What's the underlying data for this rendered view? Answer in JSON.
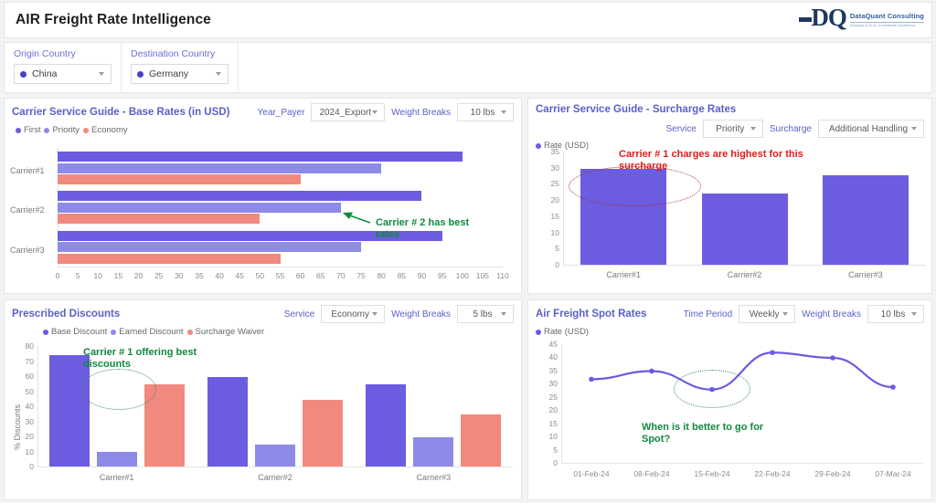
{
  "header": {
    "title": "AIR Freight Rate Intelligence",
    "logo_initials": "DQ",
    "logo_name": "DataQuant Consulting",
    "logo_tagline": "Analytics & AI for Commercial Excellence"
  },
  "filters": [
    {
      "label": "Origin Country",
      "value": "China"
    },
    {
      "label": "Destination Country",
      "value": "Germany"
    }
  ],
  "panels": {
    "base_rates": {
      "title": "Carrier Service Guide - Base Rates (in USD)",
      "controls": [
        {
          "label": "Year_Payer",
          "value": "2024_Export"
        },
        {
          "label": "Weight Breaks",
          "value": "10 lbs"
        }
      ],
      "annotation": "Carrier # 2 has best\nrates"
    },
    "surcharge_rates": {
      "title": "Carrier Service Guide - Surcharge Rates",
      "controls": [
        {
          "label": "Service",
          "value": "Priority"
        },
        {
          "label": "Surcharge",
          "value": "Additional Handling"
        }
      ],
      "annotation": "Carrier # 1 charges are highest for this\nsurcharge"
    },
    "discounts": {
      "title": "Prescribed Discounts",
      "controls": [
        {
          "label": "Service",
          "value": "Economy"
        },
        {
          "label": "Weight Breaks",
          "value": "5 lbs"
        }
      ],
      "annotation": "Carrier # 1 offering best\ndiscounts"
    },
    "spot_rates": {
      "title": "Air Freight Spot Rates",
      "controls": [
        {
          "label": "Time Period",
          "value": "Weekly"
        },
        {
          "label": "Weight Breaks",
          "value": "10 lbs"
        }
      ],
      "annotation": "When is it better to go for\nSpot?"
    }
  },
  "colors": {
    "series_first": "#6b5ce0",
    "series_priority": "#8e8ae8",
    "series_economy": "#f2897f",
    "accent": "#5b5fc7",
    "annotation_green": "#13883f",
    "annotation_red": "#e01b1b"
  },
  "chart_data": [
    {
      "id": "base_rates",
      "type": "bar",
      "orientation": "horizontal",
      "title": "Carrier Service Guide - Base Rates (in USD)",
      "categories": [
        "Carrier#1",
        "Carrier#2",
        "Carrier#3"
      ],
      "series": [
        {
          "name": "First",
          "color": "#6b5ce0",
          "values": [
            100,
            90,
            95
          ]
        },
        {
          "name": "Priority",
          "color": "#8e8ae8",
          "values": [
            80,
            70,
            75
          ]
        },
        {
          "name": "Economy",
          "color": "#f2897f",
          "values": [
            60,
            50,
            55
          ]
        }
      ],
      "xlabel": "",
      "ylabel": "",
      "xlim": [
        0,
        110
      ],
      "xticks": [
        0,
        5,
        10,
        15,
        20,
        25,
        30,
        35,
        40,
        45,
        50,
        55,
        60,
        65,
        70,
        75,
        80,
        85,
        90,
        95,
        100,
        105,
        110
      ],
      "grid": false,
      "legend_position": "top-left",
      "annotations": [
        {
          "text": "Carrier # 2 has best rates",
          "color": "#13883f",
          "points_to": "Carrier#2 Priority"
        }
      ]
    },
    {
      "id": "surcharge_rates",
      "type": "bar",
      "orientation": "vertical",
      "title": "Carrier Service Guide - Surcharge Rates",
      "categories": [
        "Carrier#1",
        "Carrier#2",
        "Carrier#3"
      ],
      "series": [
        {
          "name": "Rate (USD)",
          "color": "#6b5ce0",
          "values": [
            29.5,
            21.9,
            27.7
          ]
        }
      ],
      "xlabel": "",
      "ylabel": "Rate (USD)",
      "ylim": [
        0,
        35
      ],
      "yticks": [
        0,
        5,
        10,
        15,
        20,
        25,
        30,
        35
      ],
      "grid": false,
      "legend_position": "top-left",
      "annotations": [
        {
          "text": "Carrier # 1 charges are highest for this surcharge",
          "color": "#e01b1b",
          "highlight": "Carrier#1"
        }
      ]
    },
    {
      "id": "discounts",
      "type": "bar",
      "orientation": "vertical",
      "title": "Prescribed Discounts",
      "categories": [
        "Carrier#1",
        "Carrier#2",
        "Carrier#3"
      ],
      "series": [
        {
          "name": "Base Discount",
          "color": "#6b5ce0",
          "values": [
            74,
            59.5,
            54.5
          ]
        },
        {
          "name": "Earned Discount",
          "color": "#8e8ae8",
          "values": [
            9.5,
            14.5,
            19.5
          ]
        },
        {
          "name": "Surcharge Waiver",
          "color": "#f2897f",
          "values": [
            54.5,
            44.5,
            34.5
          ]
        }
      ],
      "xlabel": "",
      "ylabel": "% Discounts",
      "ylim": [
        0,
        80
      ],
      "yticks": [
        0,
        10,
        20,
        30,
        40,
        50,
        60,
        70,
        80
      ],
      "grid": false,
      "legend_position": "top",
      "annotations": [
        {
          "text": "Carrier # 1 offering best discounts",
          "color": "#13883f",
          "highlight": "Carrier#1"
        }
      ]
    },
    {
      "id": "spot_rates",
      "type": "line",
      "title": "Air Freight Spot Rates",
      "x": [
        "01-Feb-24",
        "08-Feb-24",
        "15-Feb-24",
        "22-Feb-24",
        "29-Feb-24",
        "07-Mar-24"
      ],
      "series": [
        {
          "name": "Rate (USD)",
          "color": "#6b5ce0",
          "values": [
            31.7,
            34.8,
            27.8,
            41.8,
            39.8,
            28.7
          ]
        }
      ],
      "xlabel": "",
      "ylabel": "Rate (USD)",
      "ylim": [
        0,
        45
      ],
      "yticks": [
        0,
        5,
        10,
        15,
        20,
        25,
        30,
        35,
        40,
        45
      ],
      "grid": false,
      "legend_position": "top-left",
      "annotations": [
        {
          "text": "When is it better to go for Spot?",
          "color": "#13883f",
          "highlight": "15-Feb-24"
        }
      ]
    }
  ]
}
